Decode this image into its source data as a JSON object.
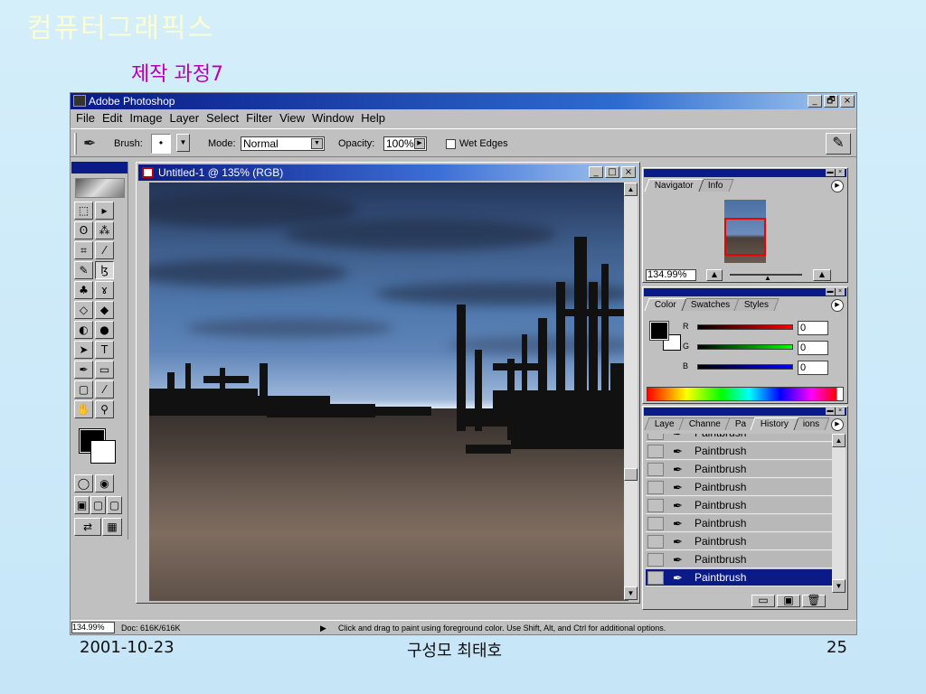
{
  "slide": {
    "title": "컴퓨터그래픽스",
    "subtitle": "제작 과정7",
    "date": "2001-10-23",
    "author": "구성모 최태호",
    "page": "25"
  },
  "app": {
    "title": "Adobe Photoshop",
    "window_buttons": [
      "_",
      "🗗",
      "×"
    ],
    "menu": [
      "File",
      "Edit",
      "Image",
      "Layer",
      "Select",
      "Filter",
      "View",
      "Window",
      "Help"
    ]
  },
  "options": {
    "brush_label": "Brush:",
    "brush_value": "•",
    "mode_label": "Mode:",
    "mode_value": "Normal",
    "opacity_label": "Opacity:",
    "opacity_value": "100%",
    "wet_edges_label": "Wet Edges",
    "wet_edges_checked": false,
    "active_tool_icon": "paintbrush-icon"
  },
  "document": {
    "title": "Untitled-1 @ 135% (RGB)",
    "window_buttons": [
      "_",
      "□",
      "×"
    ]
  },
  "navigator": {
    "tabs": [
      "Navigator",
      "Info"
    ],
    "active_tab": "Navigator",
    "zoom": "134.99%"
  },
  "color_panel": {
    "tabs": [
      "Color",
      "Swatches",
      "Styles"
    ],
    "active_tab": "Color",
    "channels": [
      {
        "label": "R",
        "value": "0",
        "color": "#d00000"
      },
      {
        "label": "G",
        "value": "0",
        "color": "#00b000"
      },
      {
        "label": "B",
        "value": "0",
        "color": "#0000c0"
      }
    ],
    "foreground": "#000000",
    "background": "#ffffff"
  },
  "history_panel": {
    "tabs": [
      "Laye",
      "Channe",
      "Pa",
      "History",
      "ions"
    ],
    "active_tab": "History",
    "items": [
      "Paintbrush",
      "Paintbrush",
      "Paintbrush",
      "Paintbrush",
      "Paintbrush",
      "Paintbrush",
      "Paintbrush",
      "Paintbrush",
      "Paintbrush"
    ],
    "selected_index": 8
  },
  "status": {
    "zoom": "134.99%",
    "doc": "Doc: 616K/616K",
    "hint": "Click and drag to paint using foreground color.  Use Shift, Alt, and Ctrl for additional options."
  },
  "toolbox": {
    "tools": [
      [
        "marquee-icon",
        "⬚",
        "move-icon",
        "▸"
      ],
      [
        "lasso-icon",
        "ʘ",
        "magic-wand-icon",
        "⁂"
      ],
      [
        "crop-icon",
        "⌗",
        "slice-icon",
        "⁄"
      ],
      [
        "healing-icon",
        "✎",
        "brush-icon",
        "ɮ"
      ],
      [
        "stamp-icon",
        "♣",
        "history-brush-icon",
        "ɤ"
      ],
      [
        "eraser-icon",
        "◇",
        "bucket-icon",
        "◆"
      ],
      [
        "blur-icon",
        "◐",
        "dodge-icon",
        "●"
      ],
      [
        "path-select-icon",
        "➤",
        "type-icon",
        "T"
      ],
      [
        "pen-icon",
        "✒",
        "rectangle-icon",
        "▭"
      ],
      [
        "notes-icon",
        "▢",
        "eyedropper-icon",
        "⁄"
      ],
      [
        "hand-icon",
        "✋",
        "zoom-icon",
        "⚲"
      ]
    ]
  }
}
